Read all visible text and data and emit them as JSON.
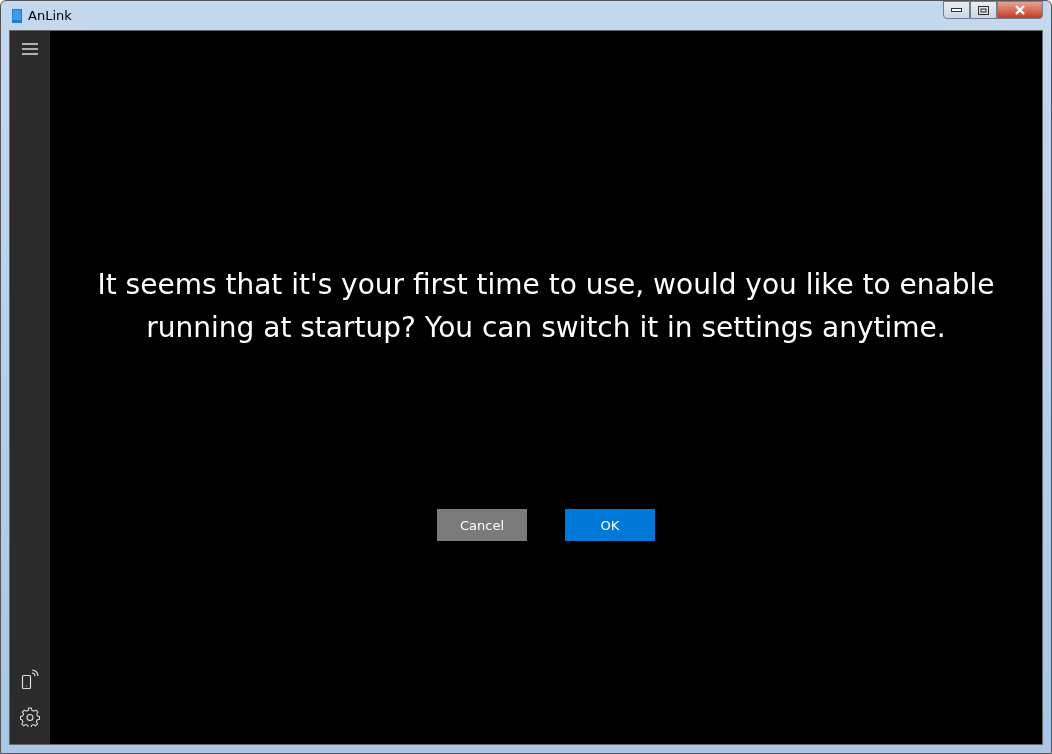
{
  "window": {
    "title": "AnLink"
  },
  "sidebar": {
    "top_items": [
      {
        "kind": "menu"
      }
    ],
    "bottom_items": [
      {
        "kind": "device"
      },
      {
        "kind": "settings"
      }
    ]
  },
  "prompt": {
    "message": "It seems that it's your first time to use, would you like to enable running at startup? You can switch it in settings anytime.",
    "buttons": [
      {
        "label": "Cancel",
        "kind": "secondary"
      },
      {
        "label": "OK",
        "kind": "primary"
      }
    ]
  }
}
